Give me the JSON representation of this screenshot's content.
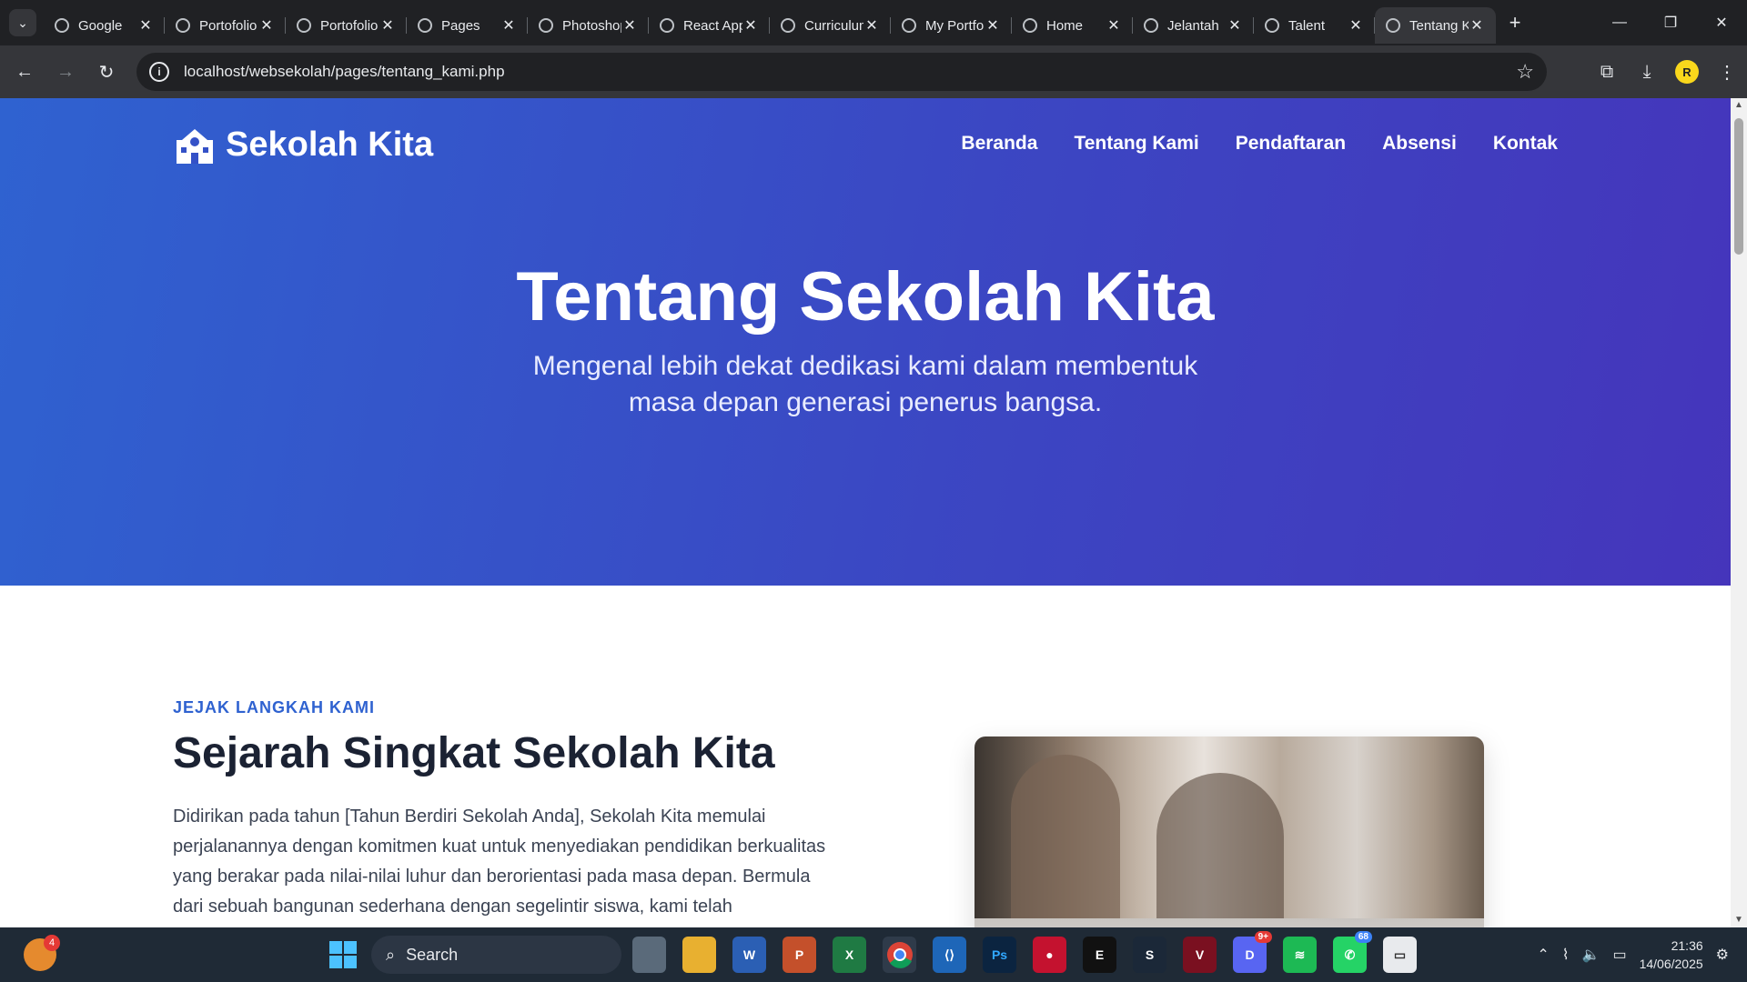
{
  "browser": {
    "tabs": [
      {
        "title": "Google",
        "icon": "gemini-icon",
        "active": false
      },
      {
        "title": "Portofolio",
        "icon": "globe-icon",
        "active": false
      },
      {
        "title": "Portofolio",
        "icon": "globe-icon",
        "active": false
      },
      {
        "title": "Pages",
        "icon": "github-icon",
        "active": false
      },
      {
        "title": "Photoshop",
        "icon": "globe-icon",
        "active": false
      },
      {
        "title": "React App",
        "icon": "react-icon",
        "active": false
      },
      {
        "title": "Curriculum",
        "icon": "globe-icon",
        "active": false
      },
      {
        "title": "My Portfolio",
        "icon": "globe-icon",
        "active": false
      },
      {
        "title": "Home",
        "icon": "figma-icon",
        "active": false
      },
      {
        "title": "Jelantah",
        "icon": "figma-icon",
        "active": false
      },
      {
        "title": "Talent",
        "icon": "figma-icon",
        "active": false
      },
      {
        "title": "Tentang Kami",
        "icon": "globe-icon",
        "active": true
      }
    ],
    "url": "localhost/websekolah/pages/tentang_kami.php",
    "profile_initial": "R"
  },
  "site": {
    "brand": "Sekolah Kita",
    "nav": [
      "Beranda",
      "Tentang Kami",
      "Pendaftaran",
      "Absensi",
      "Kontak"
    ],
    "hero_title": "Tentang Sekolah Kita",
    "hero_subtitle": "Mengenal lebih dekat dedikasi kami dalam membentuk masa depan generasi penerus bangsa.",
    "section_eyebrow": "JEJAK LANGKAH KAMI",
    "section_title": "Sejarah Singkat Sekolah Kita",
    "section_body": "Didirikan pada tahun [Tahun Berdiri Sekolah Anda], Sekolah Kita memulai perjalanannya dengan komitmen kuat untuk menyediakan pendidikan berkualitas yang berakar pada nilai-nilai luhur dan berorientasi pada masa depan. Bermula dari sebuah bangunan sederhana dengan segelintir siswa, kami telah"
  },
  "taskbar": {
    "search_label": "Search",
    "weather_badge": "4",
    "discord_badge": "9+",
    "whatsapp_badge": "68",
    "time": "21:36",
    "date": "14/06/2025"
  },
  "colors": {
    "hero_start": "#2f62d0",
    "hero_end": "#4535bb",
    "accent": "#2f62d0"
  }
}
